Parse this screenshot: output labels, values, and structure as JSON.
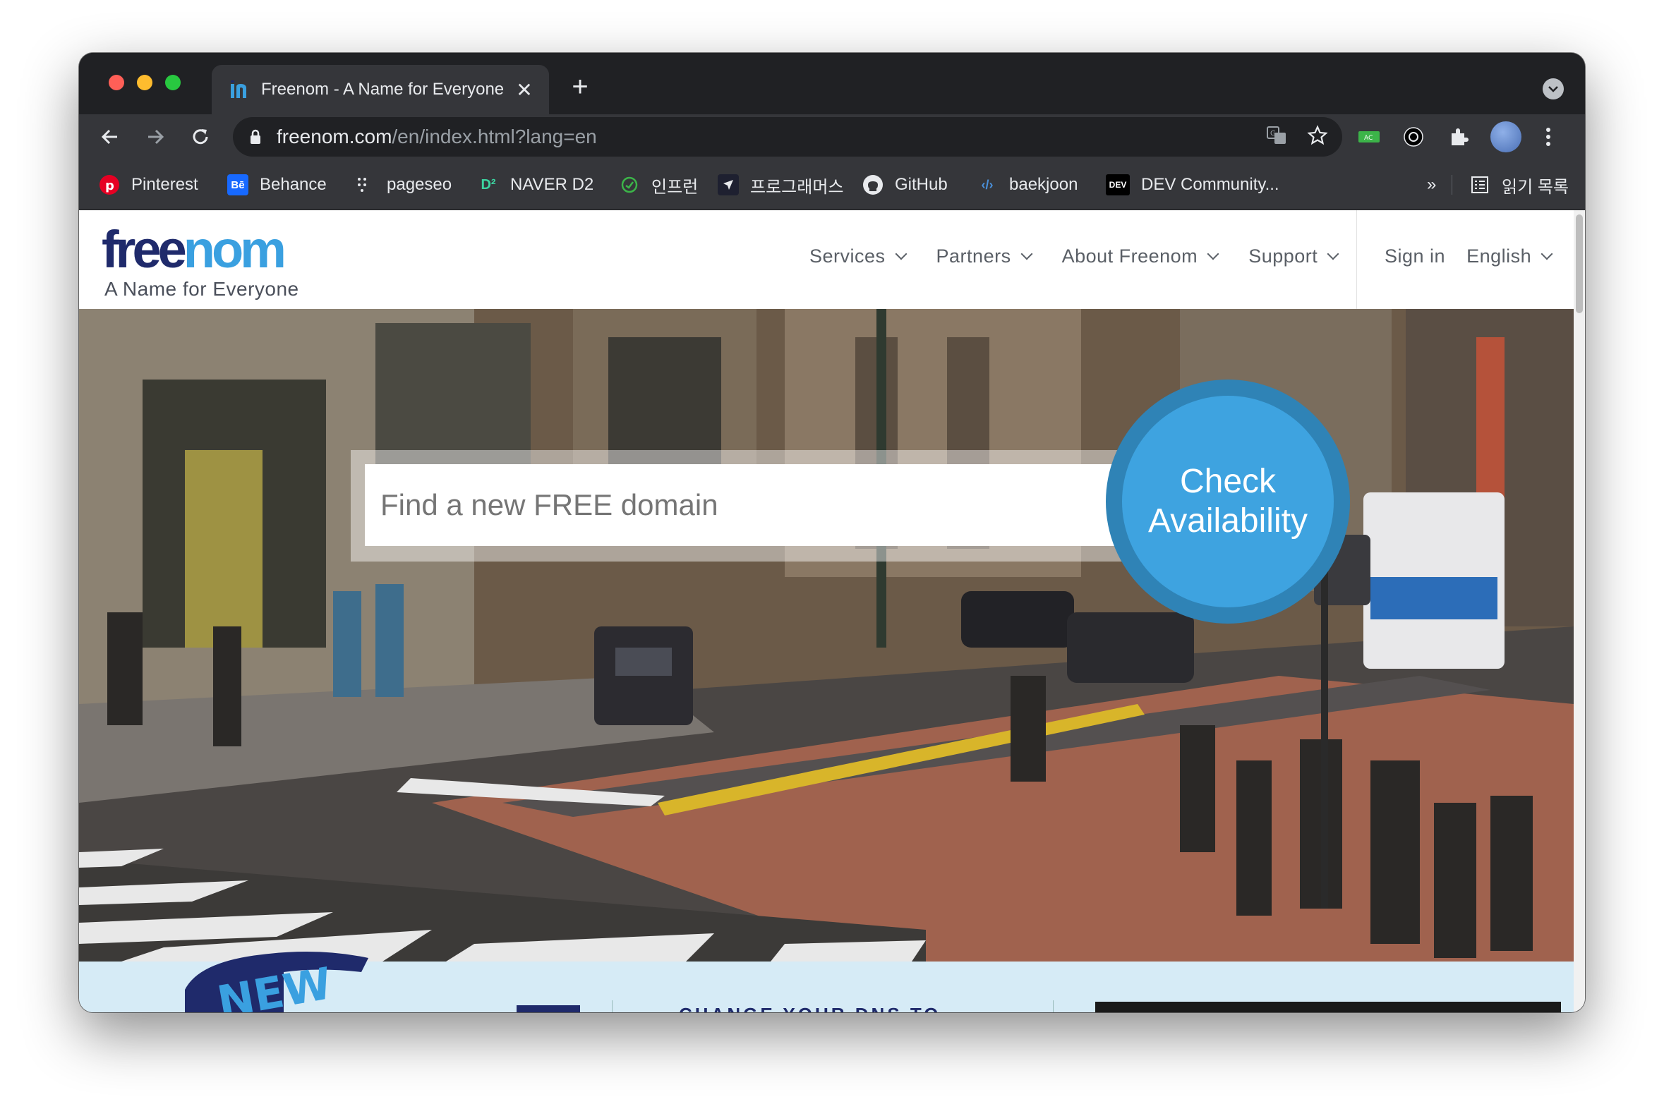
{
  "browser": {
    "tab_title": "Freenom - A Name for Everyone",
    "tab_close": "✕",
    "new_tab": "+",
    "url_host": "freenom.com",
    "url_path": "/en/index.html?lang=en",
    "ext_ac_label": "AC"
  },
  "bookmarks": [
    {
      "label": "Pinterest",
      "icon": "pinterest-icon"
    },
    {
      "label": "Behance",
      "icon": "behance-icon",
      "glyph": "Bē"
    },
    {
      "label": "pageseo",
      "icon": "pageseo-icon"
    },
    {
      "label": "NAVER D2",
      "icon": "naver-d2-icon",
      "glyph": "D²"
    },
    {
      "label": "인프런",
      "icon": "inflearn-icon"
    },
    {
      "label": "프로그래머스",
      "icon": "programmers-icon"
    },
    {
      "label": "GitHub",
      "icon": "github-icon"
    },
    {
      "label": "baekjoon",
      "icon": "baekjoon-icon",
      "glyph": "‹/›"
    },
    {
      "label": "DEV Community...",
      "icon": "dev-icon",
      "glyph": "DEV"
    }
  ],
  "bookmarks_overflow": "»",
  "reading_list": "읽기 목록",
  "site": {
    "logo_free": "free",
    "logo_nom": "nom",
    "tagline": "A Name for Everyone",
    "nav": [
      "Services",
      "Partners",
      "About Freenom",
      "Support"
    ],
    "sign_in": "Sign in",
    "language": "English"
  },
  "hero": {
    "search_placeholder": "Find a new FREE domain",
    "cta_line1": "Check",
    "cta_line2": "Availability"
  },
  "below": {
    "badge": "NEW",
    "partial_heading": "CHANGE YOUR DNS TO"
  },
  "colors": {
    "brand_dark": "#1f2a6b",
    "brand_light": "#3aa0e0",
    "cta_blue": "#3ea3e0"
  }
}
